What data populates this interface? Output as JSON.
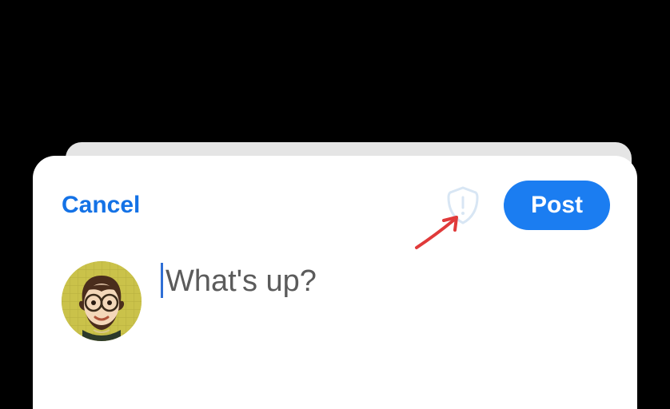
{
  "compose": {
    "cancel_label": "Cancel",
    "post_label": "Post",
    "placeholder": "What's up?",
    "input_value": ""
  },
  "icons": {
    "shield": "shield-warning-icon",
    "annotation": "annotation-arrow"
  },
  "colors": {
    "accent": "#1b7df1",
    "link": "#1472e6",
    "shield_stroke": "#d8e6f4",
    "annotation_arrow": "#e03a3a"
  }
}
